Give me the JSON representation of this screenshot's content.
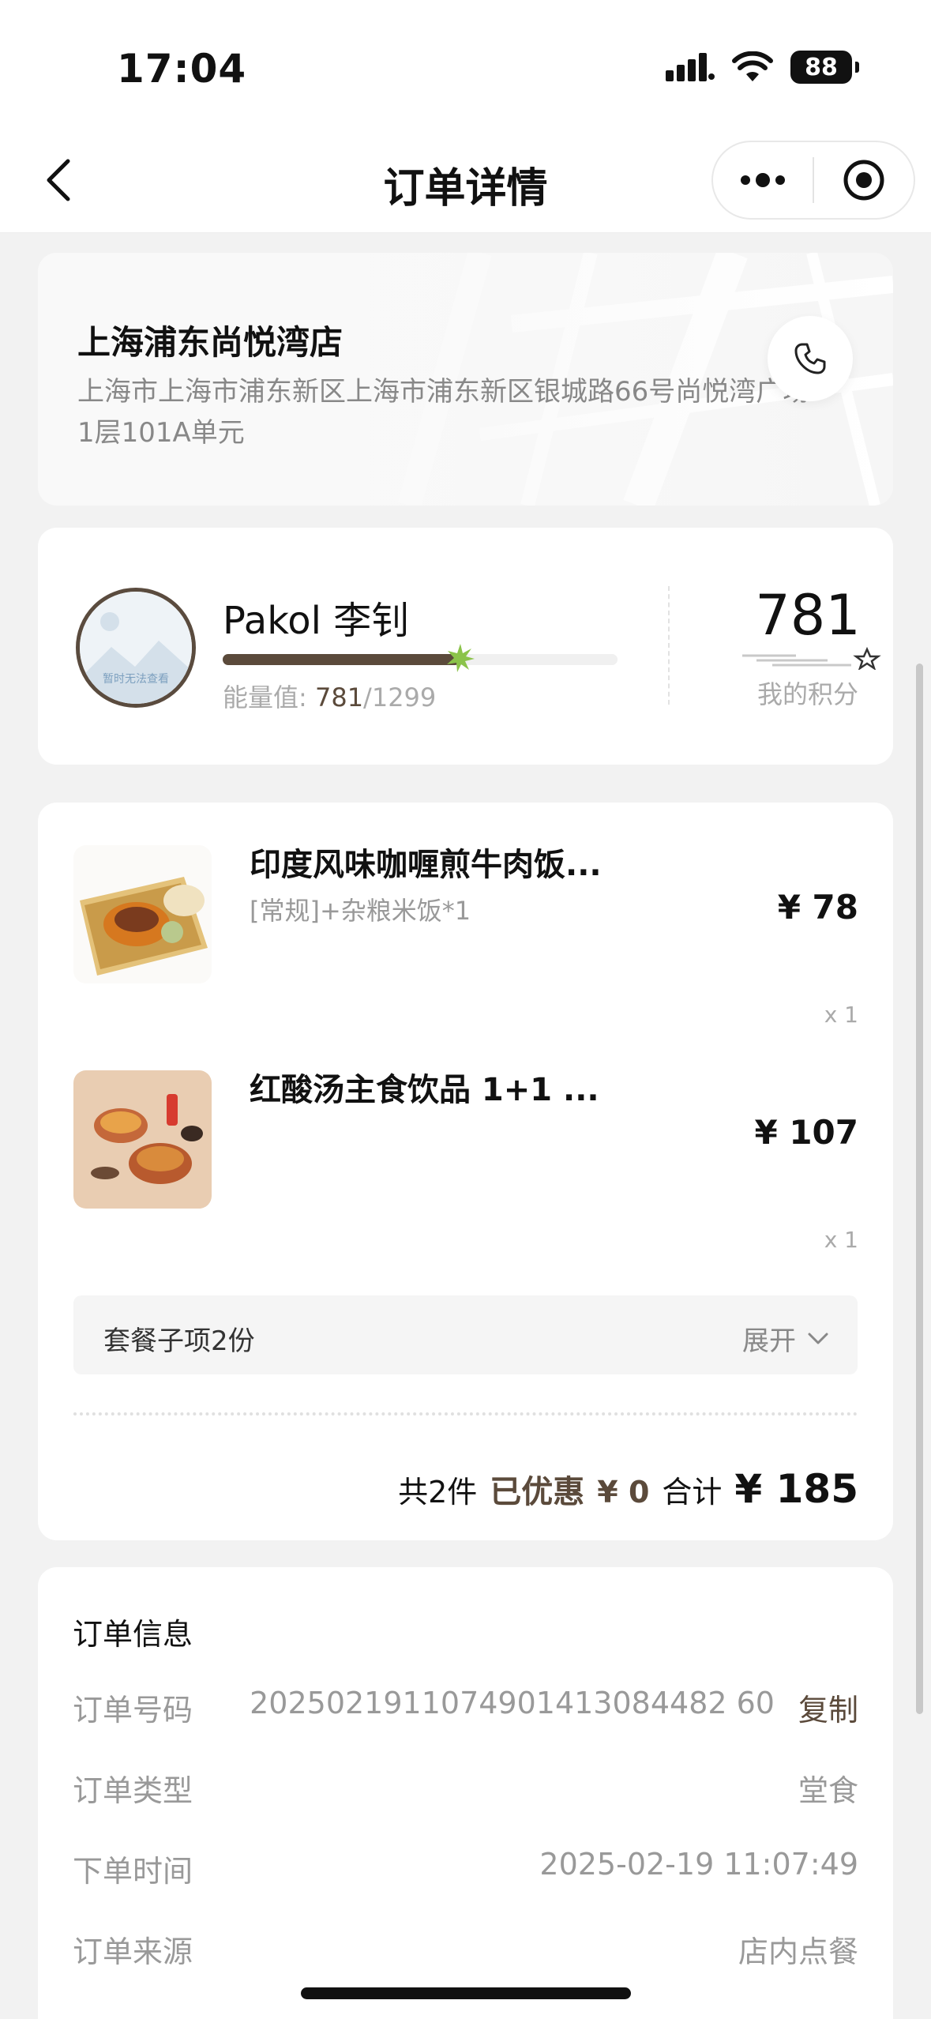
{
  "status_bar": {
    "time": "17:04",
    "battery": "88"
  },
  "nav": {
    "title": "订单详情"
  },
  "store": {
    "name": "上海浦东尚悦湾店",
    "address": "上海市上海市浦东新区上海市浦东新区银城路66号尚悦湾广场1层101A单元"
  },
  "member": {
    "avatar_text": "暂时无法查看",
    "name": "Pakol 李钊",
    "energy_label": "能量值:",
    "energy_current": "781",
    "energy_total": "/1299",
    "energy_progress": 0.601,
    "points": "781",
    "points_label": "我的积分"
  },
  "items": [
    {
      "name": "印度风味咖喱煎牛肉饭...",
      "spec": "[常规]+杂粮米饭*1",
      "price": "¥ 78",
      "qty": "x 1"
    },
    {
      "name": "红酸汤主食饮品 1+1 ...",
      "spec": "",
      "price": "¥ 107",
      "qty": "x 1"
    }
  ],
  "combo": {
    "label": "套餐子项2份",
    "expand": "展开"
  },
  "summary": {
    "count": "共2件",
    "discount_label": "已优惠",
    "discount_value": "¥ 0",
    "total_label": "合计",
    "total_value": "¥ 185"
  },
  "order_info": {
    "title": "订单信息",
    "rows": [
      {
        "key": "订单号码",
        "value": "2025021911074901413084482 60",
        "action": "复制"
      },
      {
        "key": "订单类型",
        "value": "堂食",
        "action": ""
      },
      {
        "key": "下单时间",
        "value": "2025-02-19 11:07:49",
        "action": ""
      },
      {
        "key": "订单来源",
        "value": "店内点餐",
        "action": ""
      }
    ]
  },
  "colors": {
    "accent": "#5b4a3b",
    "star": "#8bc34a"
  }
}
